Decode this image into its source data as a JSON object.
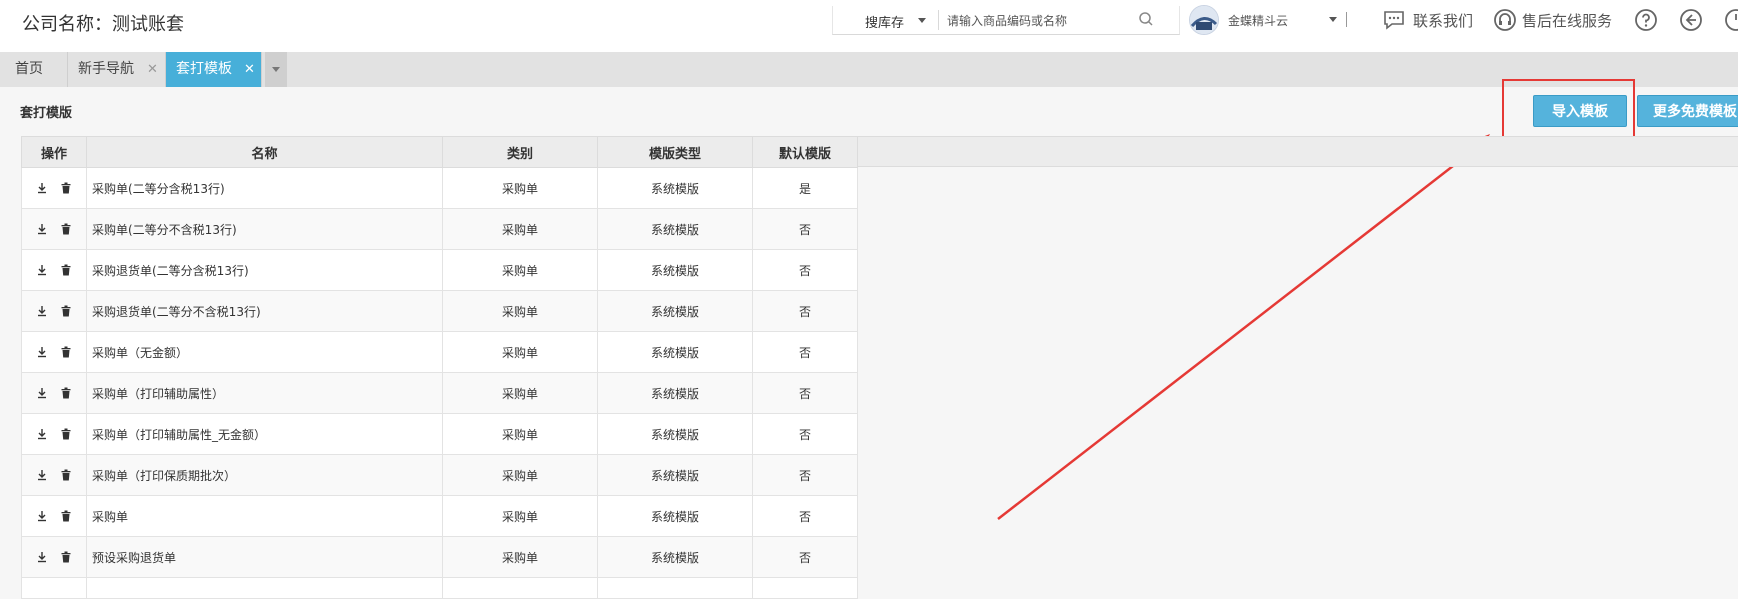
{
  "header": {
    "company": "公司名称：测试账套",
    "search_scope": "搜库存",
    "search_placeholder": "请输入商品编码或名称",
    "user_name": "金蝶精斗云",
    "contact_label": "联系我们",
    "service_label": "售后在线服务"
  },
  "tabs": [
    {
      "label": "首页",
      "closable": false,
      "active": false
    },
    {
      "label": "新手导航",
      "closable": true,
      "active": false
    },
    {
      "label": "套打模板",
      "closable": true,
      "active": true
    }
  ],
  "page": {
    "title": "套打模版",
    "import_button": "导入模板",
    "more_button": "更多免费模板"
  },
  "table": {
    "columns": [
      "操作",
      "名称",
      "类别",
      "模版类型",
      "默认模版"
    ],
    "rows": [
      {
        "name": "采购单(二等分含税13行)",
        "category": "采购单",
        "type": "系统模版",
        "default": "是"
      },
      {
        "name": "采购单(二等分不含税13行)",
        "category": "采购单",
        "type": "系统模版",
        "default": "否"
      },
      {
        "name": "采购退货单(二等分含税13行)",
        "category": "采购单",
        "type": "系统模版",
        "default": "否"
      },
      {
        "name": "采购退货单(二等分不含税13行)",
        "category": "采购单",
        "type": "系统模版",
        "default": "否"
      },
      {
        "name": "采购单（无金额）",
        "category": "采购单",
        "type": "系统模版",
        "default": "否"
      },
      {
        "name": "采购单（打印辅助属性）",
        "category": "采购单",
        "type": "系统模版",
        "default": "否"
      },
      {
        "name": "采购单（打印辅助属性_无金额）",
        "category": "采购单",
        "type": "系统模版",
        "default": "否"
      },
      {
        "name": "采购单（打印保质期批次）",
        "category": "采购单",
        "type": "系统模版",
        "default": "否"
      },
      {
        "name": "采购单",
        "category": "采购单",
        "type": "系统模版",
        "default": "否"
      },
      {
        "name": "预设采购退货单",
        "category": "采购单",
        "type": "系统模版",
        "default": "否"
      },
      {
        "name": "",
        "category": "",
        "type": "",
        "default": ""
      }
    ]
  },
  "colors": {
    "accent": "#47afd9",
    "button": "#55b3dc",
    "annotation": "#e53935"
  }
}
